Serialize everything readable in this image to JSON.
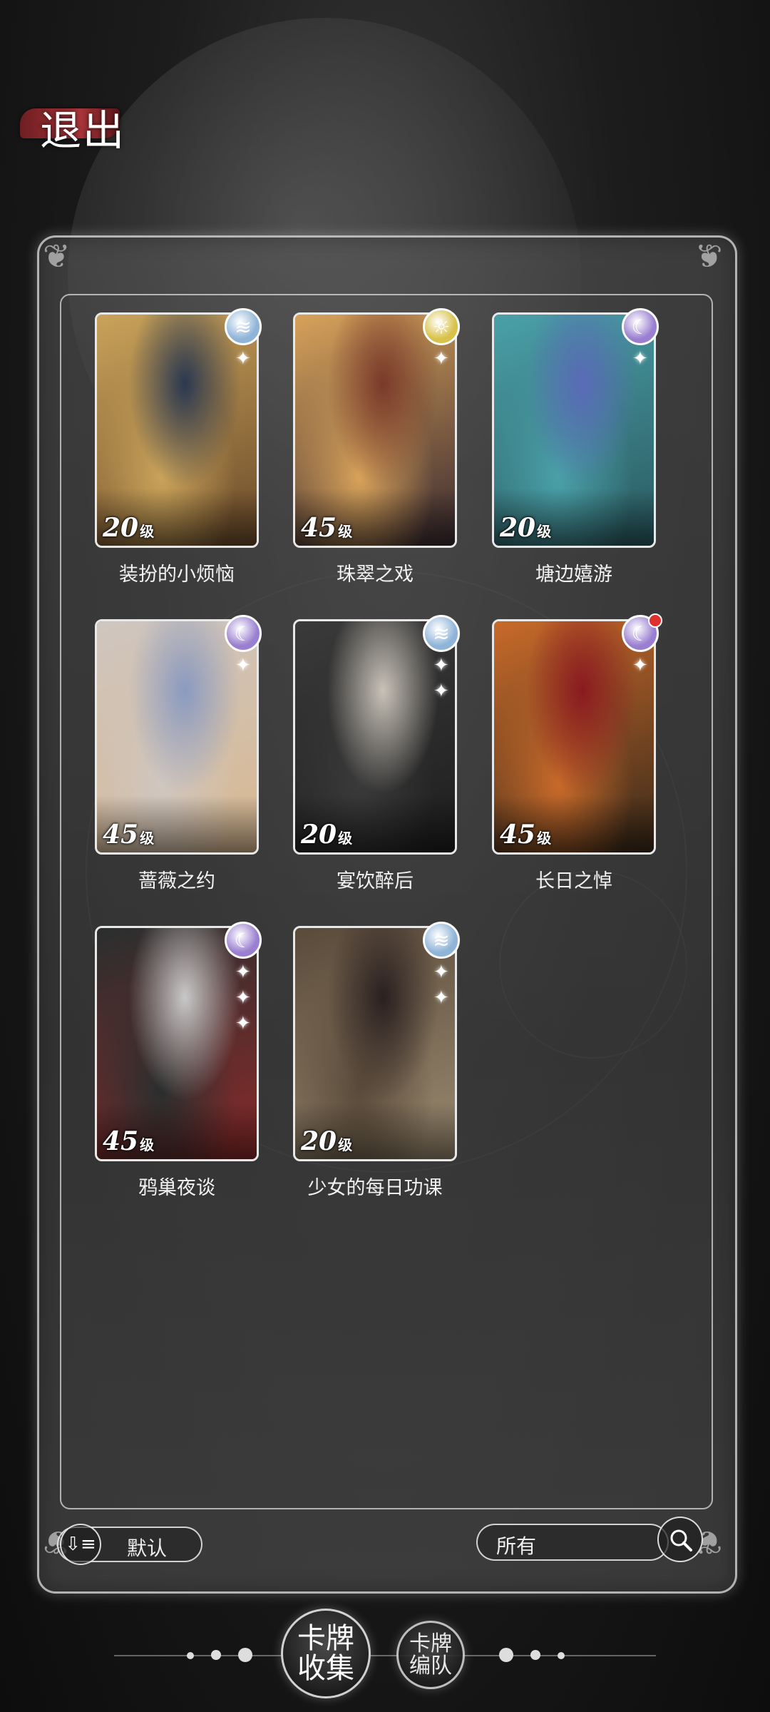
{
  "exit_label": "退出",
  "cards": [
    {
      "name": "装扮的小烦恼",
      "level": "20",
      "level_unit": "级",
      "element": "wind-icon",
      "element_color": "#8fb4d8",
      "stars": 1,
      "palette": [
        "#c9a35a",
        "#2a3850",
        "#6b4a2a"
      ]
    },
    {
      "name": "珠翠之戏",
      "level": "45",
      "level_unit": "级",
      "element": "sun-icon",
      "element_color": "#d8c24a",
      "stars": 1,
      "palette": [
        "#d7a25a",
        "#7a3a2a",
        "#3a2a30"
      ]
    },
    {
      "name": "塘边嬉游",
      "level": "20",
      "level_unit": "级",
      "element": "moon-icon",
      "element_color": "#9a7fd0",
      "stars": 1,
      "palette": [
        "#4aa0a8",
        "#5a6ab8",
        "#2a5a60"
      ]
    },
    {
      "name": "蔷薇之约",
      "level": "45",
      "level_unit": "级",
      "element": "moon-icon",
      "element_color": "#9a7fd0",
      "stars": 1,
      "palette": [
        "#cfc6c0",
        "#8a9ac0",
        "#d8b890"
      ]
    },
    {
      "name": "宴饮醉后",
      "level": "20",
      "level_unit": "级",
      "element": "wind-icon",
      "element_color": "#8fb4d8",
      "stars": 2,
      "palette": [
        "#3a3a3a",
        "#c8c2b8",
        "#1e1e1e"
      ]
    },
    {
      "name": "长日之悼",
      "level": "45",
      "level_unit": "级",
      "element": "moon-icon",
      "element_color": "#9a7fd0",
      "stars": 1,
      "palette": [
        "#c86a2a",
        "#8a1a20",
        "#3a2a1a"
      ],
      "new": true
    },
    {
      "name": "鸦巢夜谈",
      "level": "45",
      "level_unit": "级",
      "element": "moon-icon",
      "element_color": "#9a7fd0",
      "stars": 3,
      "palette": [
        "#2a2e2e",
        "#c8c8c8",
        "#8a2a2a"
      ]
    },
    {
      "name": "少女的每日功课",
      "level": "20",
      "level_unit": "级",
      "element": "wind-icon",
      "element_color": "#8fb4d8",
      "stars": 2,
      "palette": [
        "#5a4a3a",
        "#2a2020",
        "#9a8a70"
      ]
    }
  ],
  "sort": {
    "label": "默认"
  },
  "filter": {
    "label": "所有"
  },
  "nav": {
    "collection_label": "卡牌收集",
    "team_label": "卡牌编队"
  }
}
